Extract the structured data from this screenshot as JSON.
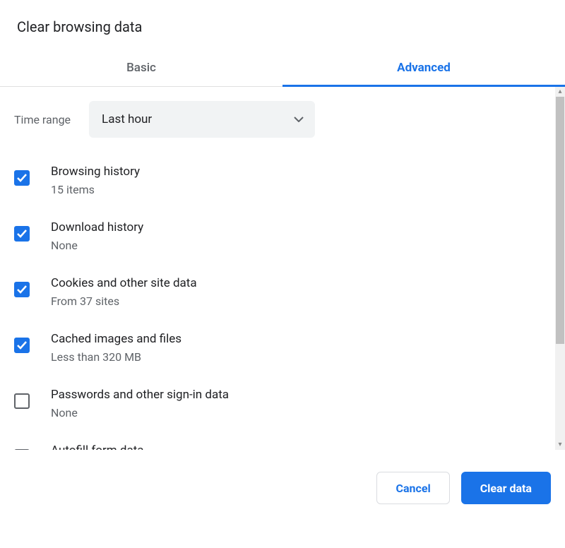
{
  "dialog": {
    "title": "Clear browsing data"
  },
  "tabs": {
    "basic": "Basic",
    "advanced": "Advanced",
    "active": "advanced"
  },
  "time_range": {
    "label": "Time range",
    "value": "Last hour"
  },
  "items": [
    {
      "checked": true,
      "title": "Browsing history",
      "sub": "15 items"
    },
    {
      "checked": true,
      "title": "Download history",
      "sub": "None"
    },
    {
      "checked": true,
      "title": "Cookies and other site data",
      "sub": "From 37 sites"
    },
    {
      "checked": true,
      "title": "Cached images and files",
      "sub": "Less than 320 MB"
    },
    {
      "checked": false,
      "title": "Passwords and other sign-in data",
      "sub": "None"
    },
    {
      "checked": false,
      "title": "Autofill form data",
      "sub": ""
    }
  ],
  "footer": {
    "cancel": "Cancel",
    "clear": "Clear data"
  }
}
